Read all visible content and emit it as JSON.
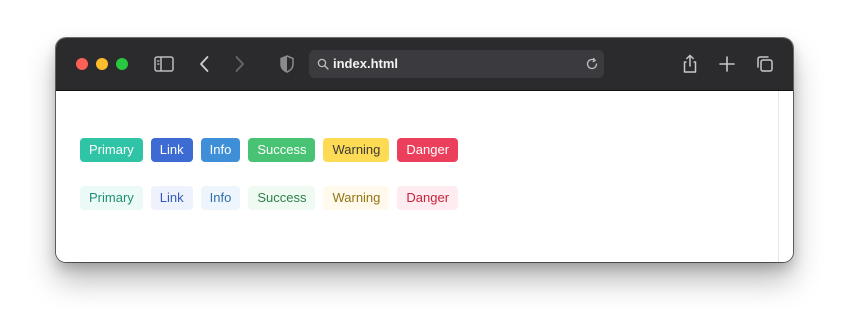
{
  "browser": {
    "url": "index.html",
    "icons": {
      "sidebar": "sidebar-toggle-icon",
      "back": "chevron-left-icon",
      "forward": "chevron-right-icon",
      "privacy": "shield-icon",
      "search": "search-icon",
      "reload": "reload-icon",
      "share": "share-icon",
      "new_tab": "plus-icon",
      "tabs": "tab-overview-icon"
    }
  },
  "buttons": {
    "solid": [
      {
        "label": "Primary",
        "bg": "#2ec4a5",
        "fg": "#ffffff"
      },
      {
        "label": "Link",
        "bg": "#3c6bd4",
        "fg": "#ffffff"
      },
      {
        "label": "Info",
        "bg": "#3f8fd8",
        "fg": "#ffffff"
      },
      {
        "label": "Success",
        "bg": "#48c374",
        "fg": "#ffffff"
      },
      {
        "label": "Warning",
        "bg": "#fedb55",
        "fg": "#3a3a3a"
      },
      {
        "label": "Danger",
        "bg": "#ec3f5b",
        "fg": "#ffffff"
      }
    ],
    "light": [
      {
        "label": "Primary",
        "bg": "#ebfaf6",
        "fg": "#1f8f74"
      },
      {
        "label": "Link",
        "bg": "#eef2fc",
        "fg": "#3559b7"
      },
      {
        "label": "Info",
        "bg": "#eef5fc",
        "fg": "#2e6fa8"
      },
      {
        "label": "Success",
        "bg": "#effaf3",
        "fg": "#2f7f4b"
      },
      {
        "label": "Warning",
        "bg": "#fffaeb",
        "fg": "#947416"
      },
      {
        "label": "Danger",
        "bg": "#feecf0",
        "fg": "#c9213b"
      }
    ]
  }
}
